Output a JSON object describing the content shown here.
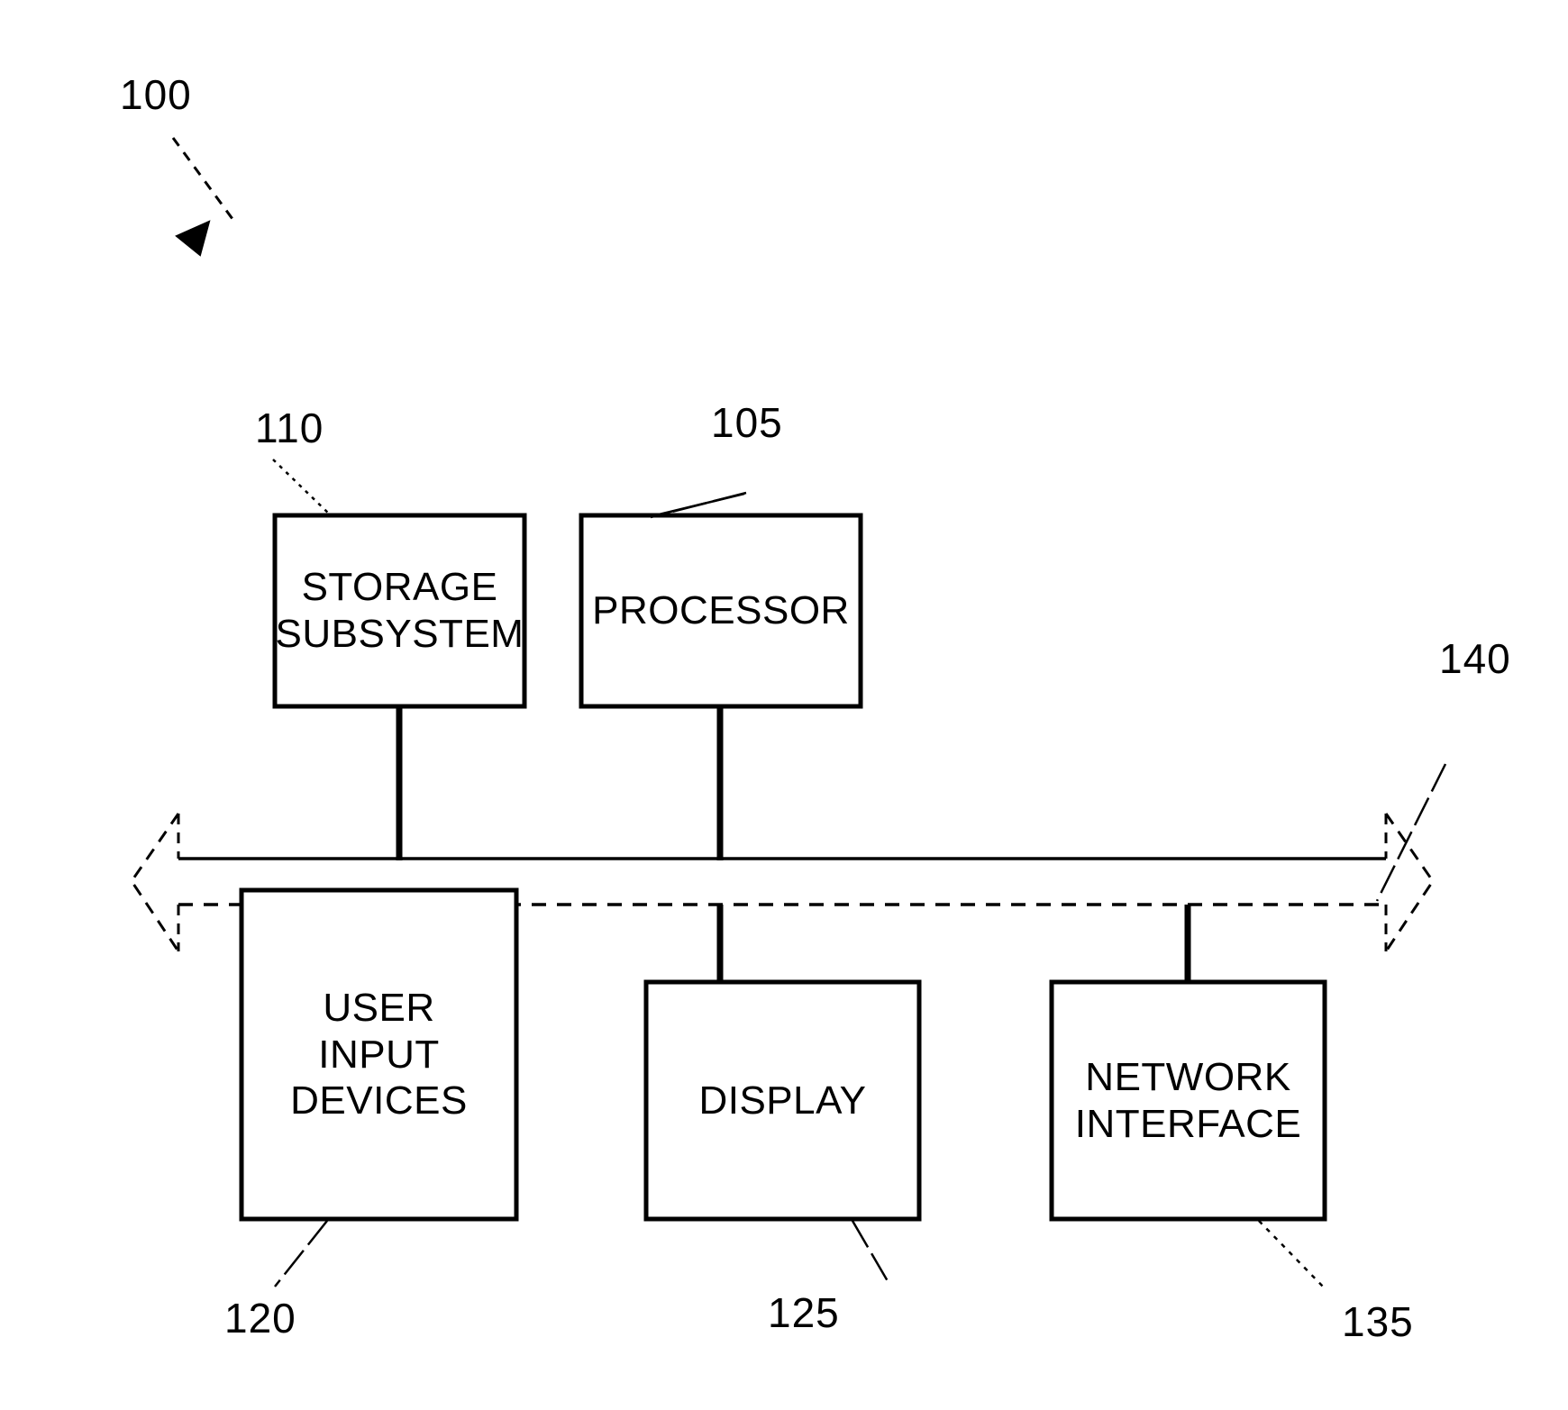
{
  "figure": {
    "title_ref": "100",
    "background_color": "#ffffff",
    "stroke_color": "#000000",
    "blocks": [
      {
        "id": "storage-subsystem",
        "lines": [
          "STORAGE",
          "SUBSYSTEM"
        ],
        "ref": "110"
      },
      {
        "id": "processor",
        "lines": [
          "PROCESSOR"
        ],
        "ref": "105"
      },
      {
        "id": "user-input-devices",
        "lines": [
          "USER",
          "INPUT",
          "DEVICES"
        ],
        "ref": "120"
      },
      {
        "id": "display",
        "lines": [
          "DISPLAY"
        ],
        "ref": "125"
      },
      {
        "id": "network-interface",
        "lines": [
          "NETWORK",
          "INTERFACE"
        ],
        "ref": "135"
      }
    ],
    "bus": {
      "id": "bus",
      "ref": "140"
    },
    "refs": {
      "system": "100",
      "processor": "105",
      "storage_subsystem": "110",
      "user_input": "120",
      "display": "125",
      "network_interface": "135",
      "bus": "140"
    },
    "block_text": {
      "storage_line1": "STORAGE",
      "storage_line2": "SUBSYSTEM",
      "processor": "PROCESSOR",
      "user_line1": "USER",
      "user_line2": "INPUT",
      "user_line3": "DEVICES",
      "display": "DISPLAY",
      "network_line1": "NETWORK",
      "network_line2": "INTERFACE"
    }
  }
}
